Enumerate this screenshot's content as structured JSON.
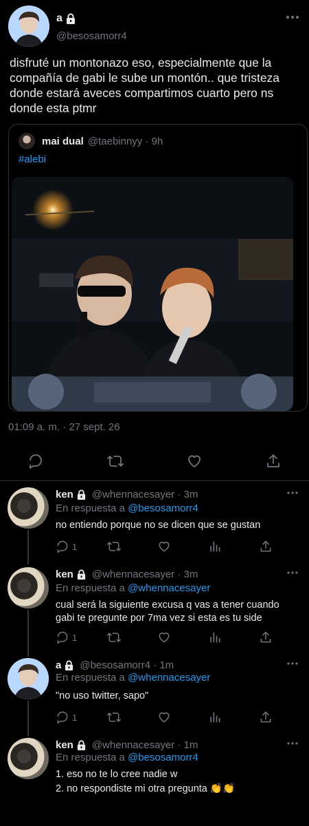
{
  "main_tweet": {
    "name": "a",
    "handle": "@besosamorr4",
    "text": " disfruté un montonazo eso, especialmente que la compañía de gabi le sube un montón.. que tristeza donde estará aveces compartimos cuarto pero ns donde esta ptmr",
    "timestamp": "01:09 a. m. · 27 sept. 26"
  },
  "quote": {
    "name": "mai dual",
    "handle_time": "@taebinnyy · 9h",
    "hashtag": "#alebi"
  },
  "replies": [
    {
      "name": "ken",
      "handle_time": "@whennacesayer · 3m",
      "replying_prefix": "En respuesta a",
      "replying_to": "@besosamorr4",
      "text": "no entiendo porque no se dicen que se gustan",
      "reply_count": "1"
    },
    {
      "name": "ken",
      "handle_time": "@whennacesayer · 3m",
      "replying_prefix": "En respuesta a",
      "replying_to": "@whennacesayer",
      "text": "cual será la siguiente excusa q vas a tener cuando gabi te pregunte por 7ma vez si esta es tu side",
      "reply_count": "1"
    },
    {
      "name": "a",
      "handle_time": "@besosamorr4 · 1m",
      "replying_prefix": "En respuesta a",
      "replying_to": "@whennacesayer",
      "text": "\"no uso twitter, sapo\"",
      "reply_count": "1"
    },
    {
      "name": "ken",
      "handle_time": "@whennacesayer · 1m",
      "replying_prefix": "En respuesta a",
      "replying_to": "@besosamorr4",
      "line1": "1. eso no te lo cree nadie w",
      "line2": "2. no respondiste mi otra pregunta",
      "emoji": "👏👏"
    }
  ],
  "icons": {
    "reply": "reply-icon",
    "retweet": "retweet-icon",
    "like": "like-icon",
    "share": "share-icon",
    "stats": "analytics-icon",
    "lock": "lock-icon",
    "more": "more-icon"
  },
  "colors": {
    "background": "#000000",
    "text": "#e7e9ea",
    "muted": "#71767b",
    "link": "#1d9bf0",
    "border": "#2f3336"
  }
}
